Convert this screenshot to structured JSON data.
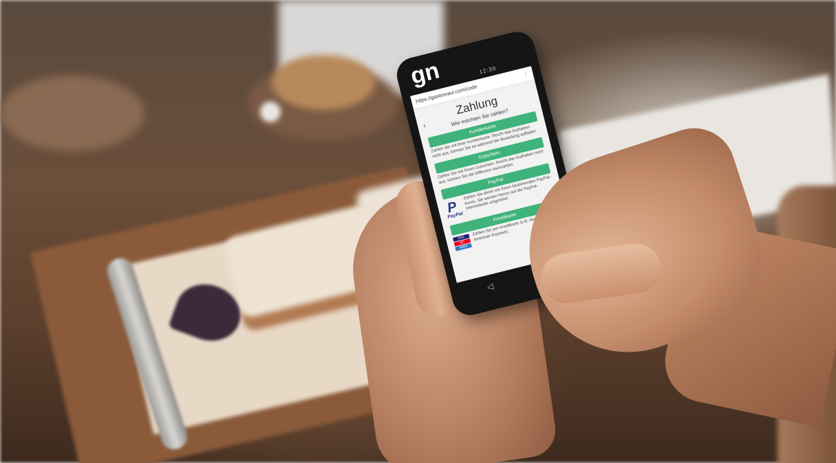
{
  "phone": {
    "status_time": "12:30",
    "logo": "gn",
    "url": "https://gastronavi.com/code",
    "menu_icon": "⋮",
    "back_icon": "‹",
    "page_title": "Zahlung",
    "question": "Wie möchten Sie zahlen?",
    "options": [
      {
        "label": "Kundenkarte",
        "description": "Zahlen Sie mit Ihrer Kundenkarte. Reicht das Guthaben nicht aus, können Sie es während der Bestellung aufladen."
      },
      {
        "label": "Gutschein",
        "description": "Zahlen Sie mit Ihrem Gutschein. Reicht das Guthaben nicht aus, können Sie die Differenz nachzahlen."
      },
      {
        "label": "PayPal",
        "description": "Zahlen Sie direkt mit Ihrem bestehenden PayPal-Konto. Sie werden hierzu auf die PayPal-Internetseite umgeleitet."
      },
      {
        "label": "Kreditkarte",
        "description": "Zahlen Sie per Kreditkarte (z.B. Mastercard, Visa, American Express)."
      }
    ],
    "paypal_word": "PayPal",
    "card_logos": [
      "VISA",
      "MC",
      "AMEX"
    ],
    "nav": {
      "back": "◁",
      "home": "○"
    }
  },
  "colors": {
    "accent_green": "#3fb37a",
    "paypal_blue": "#253b80",
    "phone_body": "#151515"
  }
}
